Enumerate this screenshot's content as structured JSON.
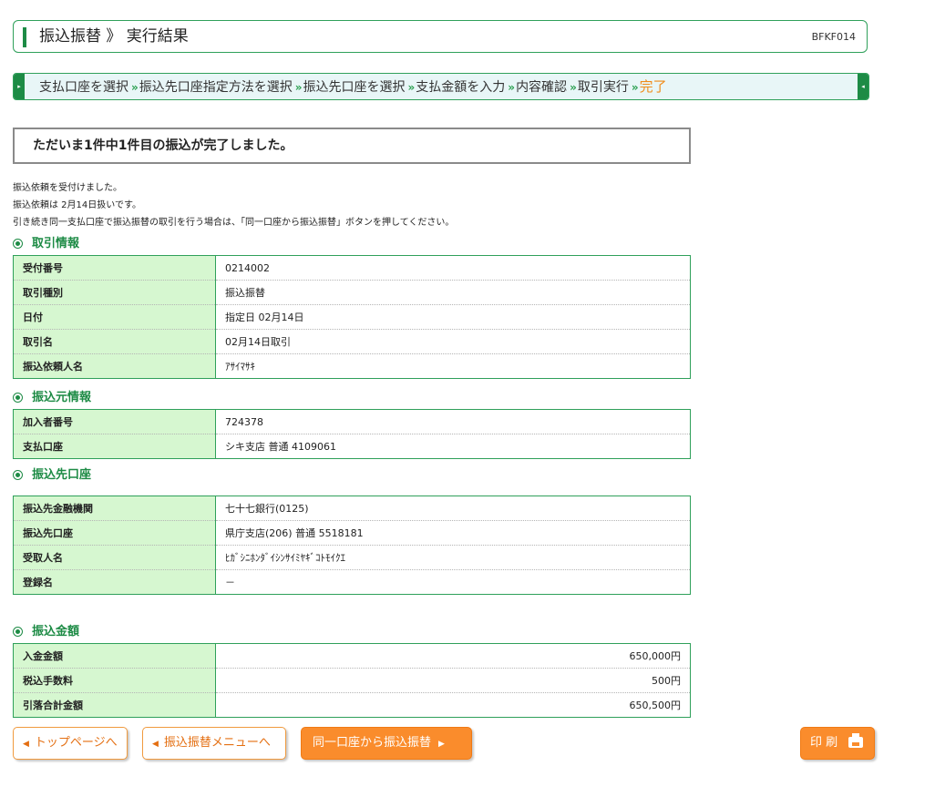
{
  "header": {
    "title": "振込振替 》 実行結果",
    "screen_code": "BFKF014"
  },
  "steps": [
    {
      "label": "支払口座を選択"
    },
    {
      "label": "振込先口座指定方法を選択"
    },
    {
      "label": "振込先口座を選択"
    },
    {
      "label": "支払金額を入力"
    },
    {
      "label": "内容確認"
    },
    {
      "label": "取引実行"
    },
    {
      "label": "完了",
      "current": true
    }
  ],
  "step_separator": "»",
  "completion_message": "ただいま1件中1件目の振込が完了しました。",
  "messages": [
    "振込依頼を受付けました。",
    "振込依頼は 2月14日扱いです。",
    "引き続き同一支払口座で振込振替の取引を行う場合は、「同一口座から振込振替」ボタンを押してください。"
  ],
  "sections": {
    "transaction": {
      "title": "取引情報",
      "rows": [
        {
          "label": "受付番号",
          "value": "0214002"
        },
        {
          "label": "取引種別",
          "value": "振込振替"
        },
        {
          "label": "日付",
          "value": "指定日 02月14日"
        },
        {
          "label": "取引名",
          "value": "02月14日取引"
        },
        {
          "label": "振込依頼人名",
          "value": "ｱｻｲﾏｻｷ"
        }
      ]
    },
    "source": {
      "title": "振込元情報",
      "rows": [
        {
          "label": "加入者番号",
          "value": "724378"
        },
        {
          "label": "支払口座",
          "value": "シキ支店 普通 4109061"
        }
      ]
    },
    "destination": {
      "title": "振込先口座",
      "rows": [
        {
          "label": "振込先金融機関",
          "value": "七十七銀行(0125)"
        },
        {
          "label": "振込先口座",
          "value": "県庁支店(206) 普通 5518181"
        },
        {
          "label": "受取人名",
          "value": "ﾋｶﾞｼﾆﾎﾝﾀﾞｲｼﾝｻｲﾐﾔｷﾞｺﾄﾓｲｸｴ"
        },
        {
          "label": "登録名",
          "value": "－"
        }
      ]
    },
    "amount": {
      "title": "振込金額",
      "rows": [
        {
          "label": "入金金額",
          "value": "650,000円"
        },
        {
          "label": "税込手数料",
          "value": "500円"
        },
        {
          "label": "引落合計金額",
          "value": "650,500円"
        }
      ]
    }
  },
  "buttons": {
    "top_page": "トップページへ",
    "transfer_menu": "振込振替メニューへ",
    "same_account": "同一口座から振込振替",
    "print": "印 刷"
  },
  "colors": {
    "accent_green": "#1d8b45",
    "label_bg": "#d6f7d0",
    "button_orange": "#fa8c2c",
    "current_step": "#f08c1a"
  }
}
